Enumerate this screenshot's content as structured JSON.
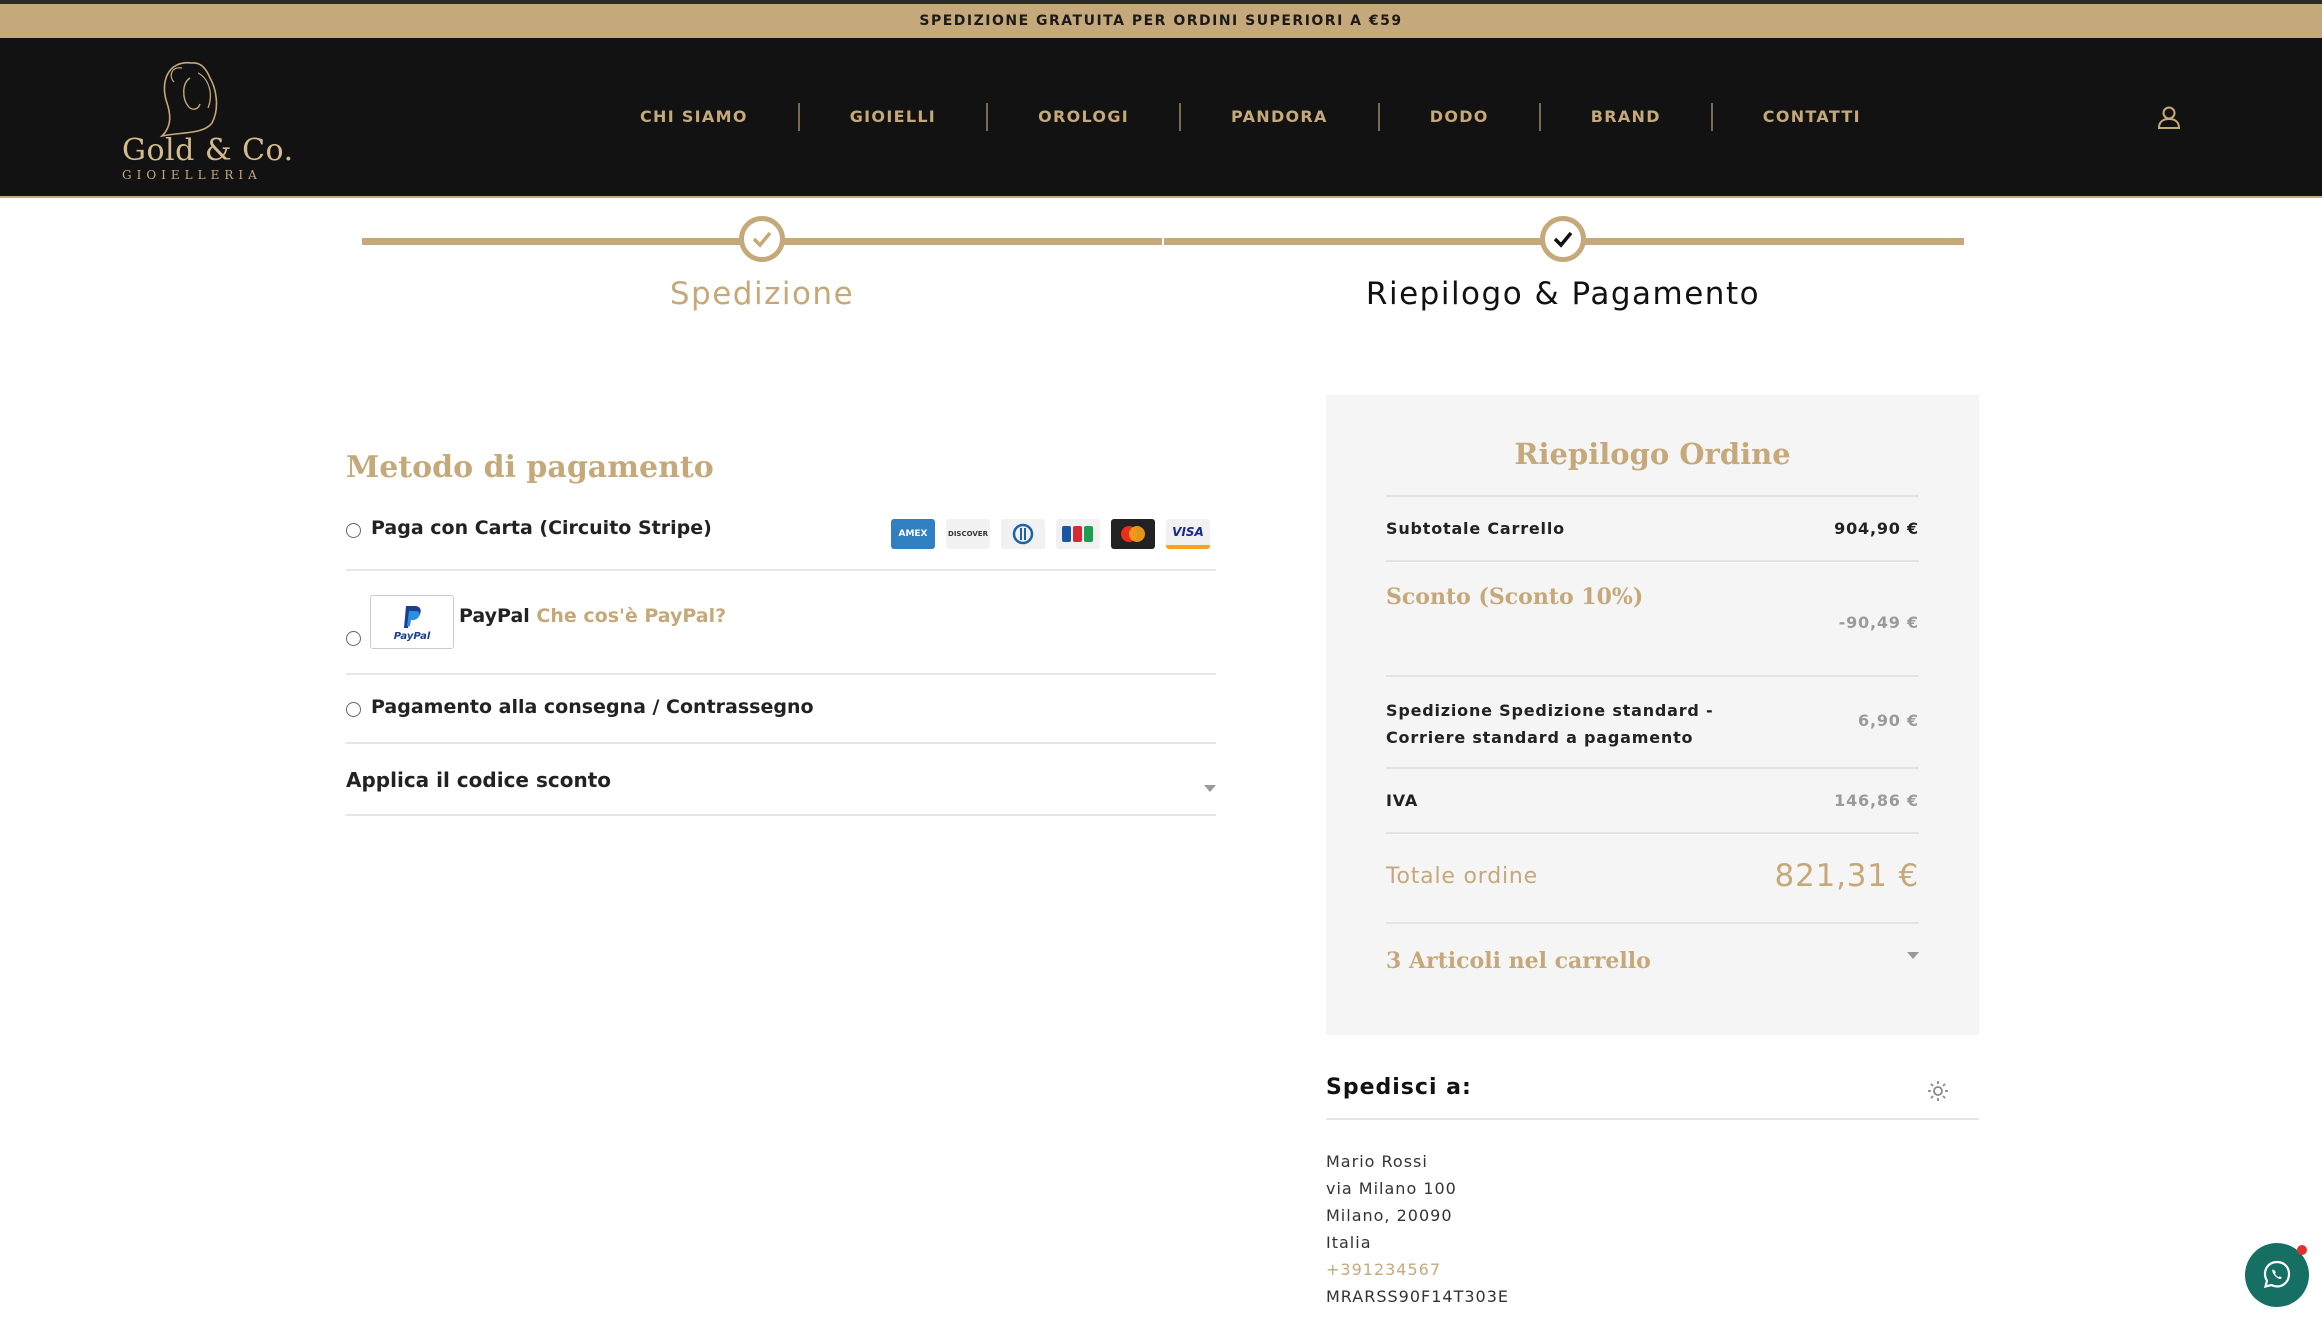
{
  "topbar": {
    "text": "SPEDIZIONE GRATUITA PER ORDINI SUPERIORI A €59"
  },
  "logo": {
    "name": "Gold & Co.",
    "sub": "GIOIELLERIA"
  },
  "nav": [
    "CHI SIAMO",
    "GIOIELLI",
    "OROLOGI",
    "PANDORA",
    "DODO",
    "BRAND",
    "CONTATTI"
  ],
  "steps": [
    {
      "label": "Spedizione",
      "state": "done"
    },
    {
      "label": "Riepilogo & Pagamento",
      "state": "current"
    }
  ],
  "payment": {
    "title": "Metodo di pagamento",
    "options": [
      {
        "label": "Paga con Carta (Circuito Stripe)",
        "cards": [
          "AMEX",
          "DISCOVER",
          "DINERS",
          "JCB",
          "MASTERCARD",
          "VISA"
        ]
      },
      {
        "label": "PayPal",
        "link": "Che cos'è PayPal?",
        "logo_text": "PayPal"
      },
      {
        "label": "Pagamento alla consegna / Contrassegno"
      }
    ],
    "coupon_label": "Applica il codice sconto"
  },
  "summary": {
    "title": "Riepilogo Ordine",
    "subtotal_label": "Subtotale Carrello",
    "subtotal_value": "904,90 €",
    "discount_label": "Sconto (Sconto 10%)",
    "discount_value": "-90,49 €",
    "shipping_label": "Spedizione Spedizione standard - Corriere standard a pagamento",
    "shipping_value": "6,90 €",
    "vat_label": "IVA",
    "vat_value": "146,86 €",
    "total_label": "Totale ordine",
    "total_value": "821,31 €",
    "items_label": "3 Articoli nel carrello"
  },
  "shipping_to": {
    "title": "Spedisci a:",
    "lines": [
      "Mario Rossi",
      "via Milano 100",
      "Milano, 20090",
      "Italia"
    ],
    "phone": "+391234567",
    "tax_code": "MRARSS90F14T303E"
  },
  "colors": {
    "gold": "#c6a97a",
    "dark": "#121212",
    "panel": "#f5f5f5",
    "whatsapp": "#157063"
  }
}
